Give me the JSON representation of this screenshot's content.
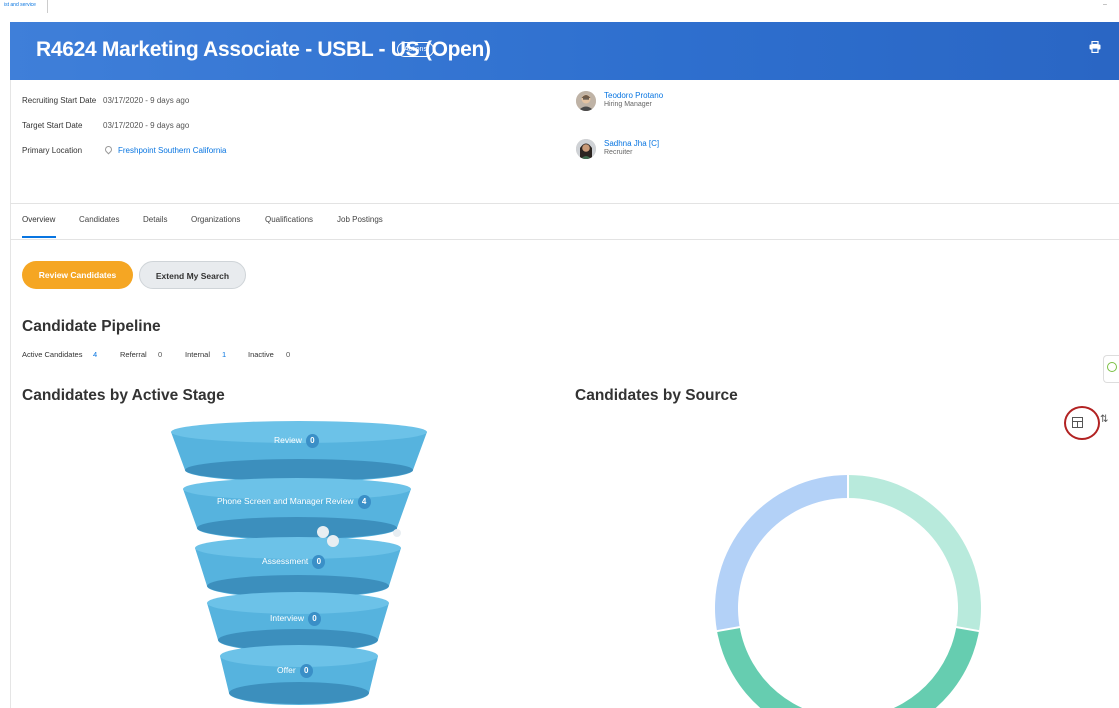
{
  "topbar": {
    "breadcrumb": "ist and service",
    "minimize": "–"
  },
  "header": {
    "title": "R4624 Marketing Associate - USBL - US (Open)",
    "actions_label": "Actions",
    "print_icon": "printer-icon"
  },
  "details": [
    {
      "label": "Recruiting Start Date",
      "value": "03/17/2020 - 9 days ago"
    },
    {
      "label": "Target Start Date",
      "value": "03/17/2020 - 9 days ago"
    },
    {
      "label": "Primary Location",
      "value": "Freshpoint Southern California"
    }
  ],
  "people": [
    {
      "name": "Teodoro Protano",
      "role": "Hiring Manager"
    },
    {
      "name": "Sadhna Jha [C]",
      "role": "Recruiter"
    }
  ],
  "tabs": [
    "Overview",
    "Candidates",
    "Details",
    "Organizations",
    "Qualifications",
    "Job Postings"
  ],
  "buttons": {
    "review": "Review Candidates",
    "extend": "Extend My Search"
  },
  "pipeline": {
    "title": "Candidate Pipeline",
    "stats": [
      {
        "label": "Active Candidates",
        "value": "4"
      },
      {
        "label": "Referral",
        "value": "0"
      },
      {
        "label": "Internal",
        "value": "1"
      },
      {
        "label": "Inactive",
        "value": "0"
      }
    ]
  },
  "stage_chart": {
    "title": "Candidates by Active Stage",
    "stages": [
      {
        "label": "Review",
        "count": "0"
      },
      {
        "label": "Phone Screen and Manager Review",
        "count": "4"
      },
      {
        "label": "Assessment",
        "count": "0"
      },
      {
        "label": "Interview",
        "count": "0"
      },
      {
        "label": "Offer",
        "count": "0"
      }
    ],
    "color": "#56b3de"
  },
  "source_chart": {
    "title": "Candidates by Source",
    "colors": [
      "#b8eadc",
      "#66cdb0",
      "#b3d1f7"
    ]
  }
}
